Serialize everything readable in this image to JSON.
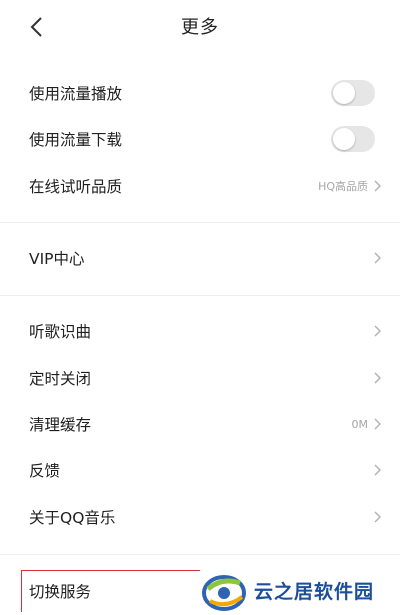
{
  "header": {
    "title": "更多"
  },
  "settings": [
    {
      "label": "使用流量播放",
      "type": "toggle",
      "on": false
    },
    {
      "label": "使用流量下载",
      "type": "toggle",
      "on": false
    },
    {
      "label": "在线试听品质",
      "type": "link",
      "value": "HQ高品质"
    },
    {
      "label": "VIP中心",
      "type": "link"
    },
    {
      "label": "听歌识曲",
      "type": "link"
    },
    {
      "label": "定时关闭",
      "type": "link"
    },
    {
      "label": "清理缓存",
      "type": "link",
      "value": "0M"
    },
    {
      "label": "反馈",
      "type": "link"
    },
    {
      "label": "关于QQ音乐",
      "type": "link"
    },
    {
      "label": "切换服务",
      "type": "link",
      "highlighted": true
    }
  ],
  "watermark": {
    "text": "云之居软件园"
  },
  "colors": {
    "highlight": "#d6303a",
    "toggle_off": "#e6e6e6",
    "chevron": "#b3b3b3"
  }
}
